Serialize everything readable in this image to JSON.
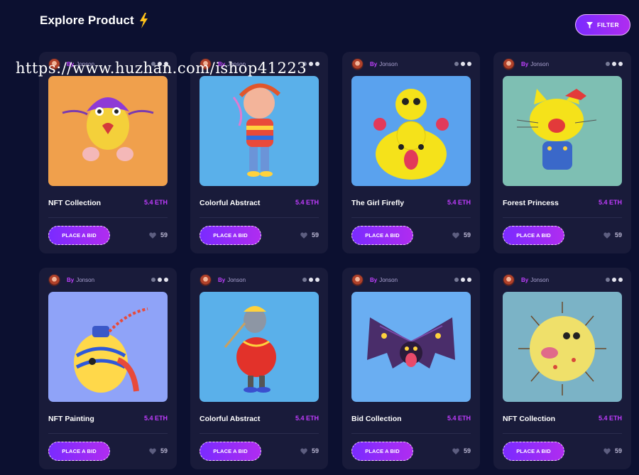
{
  "header": {
    "title": "Explore Product"
  },
  "filter": {
    "label": "FILTER"
  },
  "watermark": "https://www.huzhan.com/ishop41223",
  "cards": [
    {
      "author_prefix": "By",
      "author": "Jonson",
      "name": "NFT Collection",
      "price": "5.4 ETH",
      "bid_label": "PLACE A BID",
      "likes": "59",
      "bg": "#f0a04c",
      "subject": "purple-helmet-creature"
    },
    {
      "author_prefix": "By",
      "author": "Jonson",
      "name": "Colorful Abstract",
      "price": "5.4 ETH",
      "bid_label": "PLACE A BID",
      "likes": "59",
      "bg": "#5ab0ea",
      "subject": "striped-shirt-boy"
    },
    {
      "author_prefix": "By",
      "author": "Jonson",
      "name": "The Girl Firefly",
      "price": "5.4 ETH",
      "bid_label": "PLACE A BID",
      "likes": "59",
      "bg": "#5aa2ee",
      "subject": "yellow-monster-stack"
    },
    {
      "author_prefix": "By",
      "author": "Jonson",
      "name": "Forest Princess",
      "price": "5.4 ETH",
      "bid_label": "PLACE A BID",
      "likes": "59",
      "bg": "#7ebfb3",
      "subject": "yellow-cat-overalls"
    },
    {
      "author_prefix": "By",
      "author": "Jonson",
      "name": "NFT Painting",
      "price": "5.4 ETH",
      "bid_label": "PLACE A BID",
      "likes": "59",
      "bg": "#8fa3f8",
      "subject": "painted-vase-creature"
    },
    {
      "author_prefix": "By",
      "author": "Jonson",
      "name": "Colorful Abstract",
      "price": "5.4 ETH",
      "bid_label": "PLACE A BID",
      "likes": "59",
      "bg": "#5ab0ea",
      "subject": "pigeon-red-jacket"
    },
    {
      "author_prefix": "By",
      "author": "Jonson",
      "name": "Bid Collection",
      "price": "5.4 ETH",
      "bid_label": "PLACE A BID",
      "likes": "59",
      "bg": "#6aaef2",
      "subject": "purple-bat-creature"
    },
    {
      "author_prefix": "By",
      "author": "Jonson",
      "name": "NFT Collection",
      "price": "5.4 ETH",
      "bid_label": "PLACE A BID",
      "likes": "59",
      "bg": "#7bb3c6",
      "subject": "spiky-pufferfish"
    }
  ]
}
